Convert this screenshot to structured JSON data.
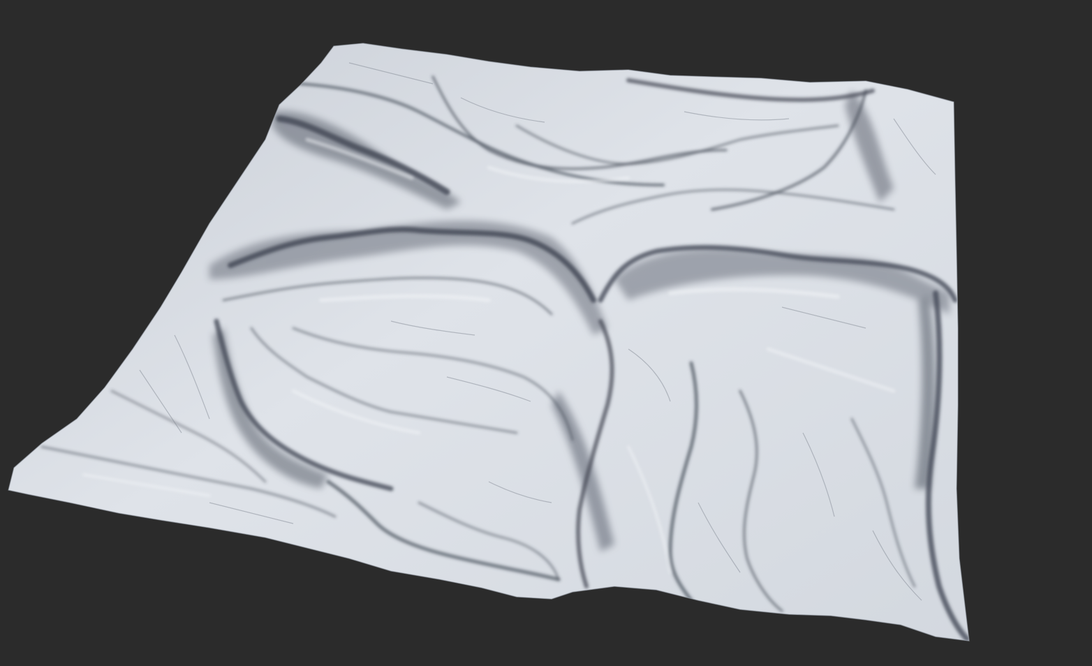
{
  "scene": {
    "background_color": "#2b2b2b",
    "surface_color": "#d9dde3",
    "shadow_color": "#3a3f4a",
    "subject": "terrain-heightmap-render"
  }
}
